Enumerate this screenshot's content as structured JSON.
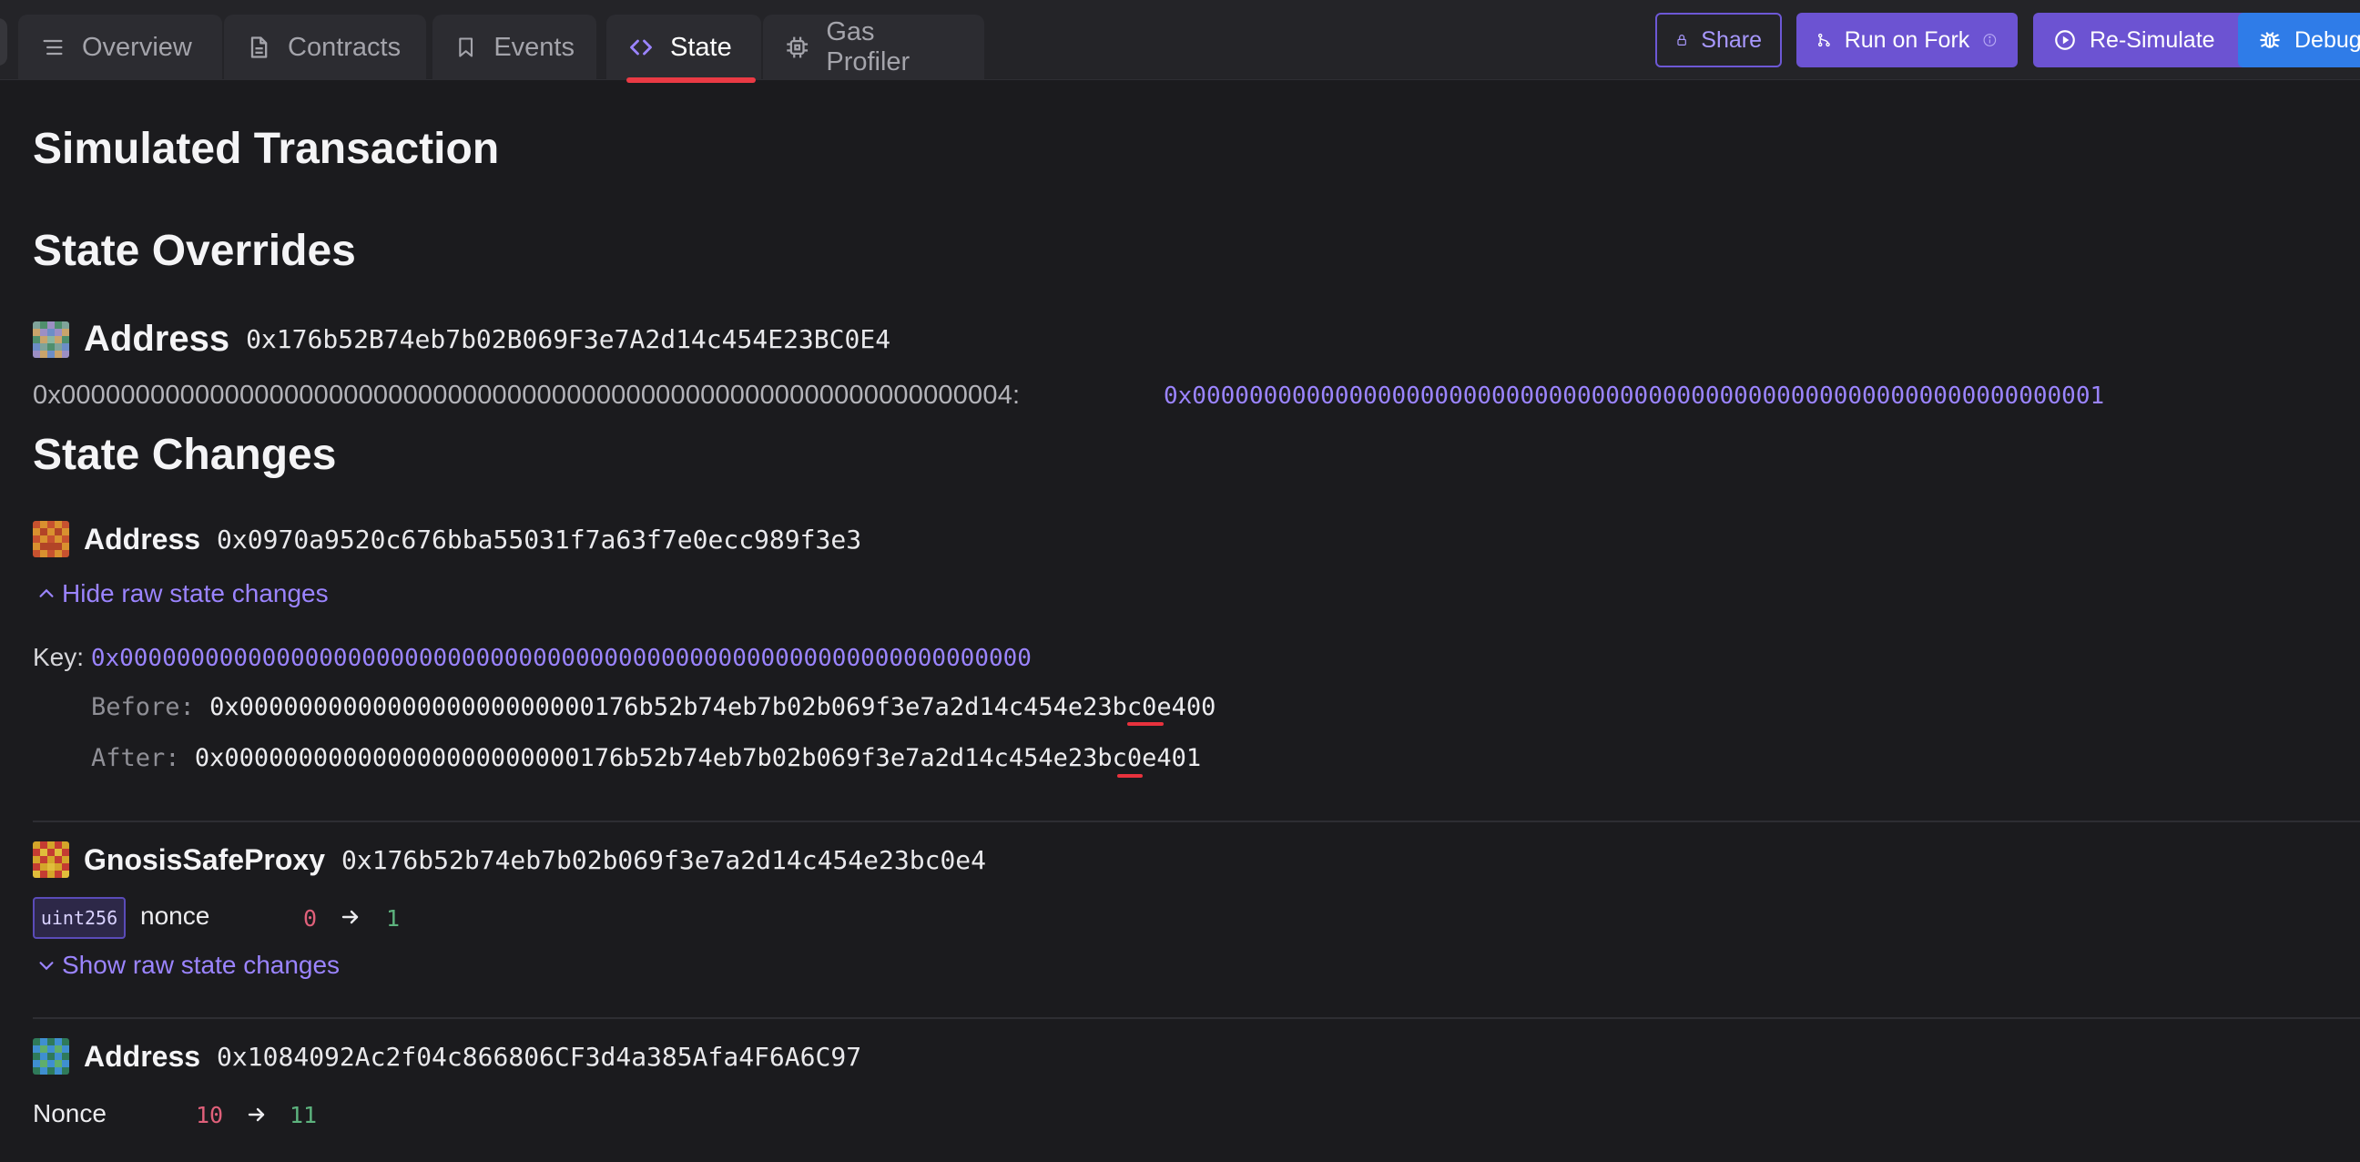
{
  "tabs": [
    {
      "label": "Overview",
      "icon": "list-icon"
    },
    {
      "label": "Contracts",
      "icon": "document-icon"
    },
    {
      "label": "Events",
      "icon": "bookmark-icon"
    },
    {
      "label": "State",
      "icon": "code-icon",
      "active": true
    },
    {
      "label": "Gas Profiler",
      "icon": "chip-icon"
    }
  ],
  "actions": {
    "share": "Share",
    "run_on_fork": "Run on Fork",
    "re_simulate": "Re-Simulate",
    "debugger": "Debugg"
  },
  "page": {
    "title": "Simulated Transaction",
    "overrides_title": "State Overrides",
    "changes_title": "State Changes"
  },
  "overrides": [
    {
      "label": "Address",
      "address": "0x176b52B74eb7b02B069F3e7A2d14c454E23BC0E4",
      "slot": "0x0000000000000000000000000000000000000000000000000000000000000004:",
      "value": "0x0000000000000000000000000000000000000000000000000000000000000001"
    }
  ],
  "changes": [
    {
      "label": "Address",
      "address": "0x0970a9520c676bba55031f7a63f7e0ecc989f3e3",
      "toggle": "Hide raw state changes",
      "key_label": "Key:",
      "key": "0x0000000000000000000000000000000000000000000000000000000000000000",
      "before_label": "Before:",
      "before": "0x000000000000000000000000176b52b74eb7b02b069f3e7a2d14c454e23bc0e400",
      "after_label": "After:",
      "after": "0x000000000000000000000000176b52b74eb7b02b069f3e7a2d14c454e23bc0e401"
    },
    {
      "label": "GnosisSafeProxy",
      "address": "0x176b52b74eb7b02b069f3e7a2d14c454e23bc0e4",
      "type": "uint256",
      "var": "nonce",
      "old": "0",
      "new": "1",
      "toggle": "Show raw state changes"
    },
    {
      "label": "Address",
      "address": "0x1084092Ac2f04c866806CF3d4a385Afa4F6A6C97",
      "var": "Nonce",
      "old": "10",
      "new": "11"
    }
  ],
  "colors": {
    "accent": "#6c53d2",
    "accent_text": "#9b84ff",
    "debugger": "#2f7ce8",
    "old_value": "#e0607a",
    "new_value": "#5db37e",
    "highlight": "#e8323d"
  }
}
